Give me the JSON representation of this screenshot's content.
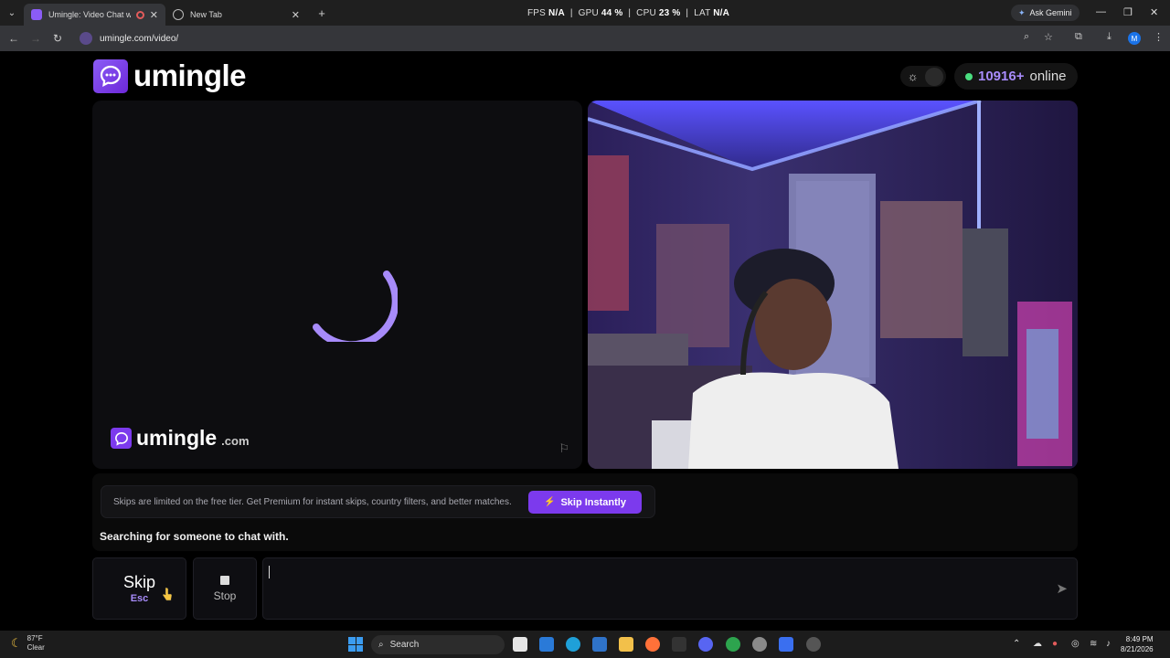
{
  "browser": {
    "tabs": [
      {
        "title": "Umingle: Video Chat with St",
        "active": true
      },
      {
        "title": "New Tab",
        "active": false
      }
    ],
    "perf": {
      "fps_label": "FPS",
      "fps": "N/A",
      "gpu_label": "GPU",
      "gpu": "44 %",
      "cpu_label": "CPU",
      "cpu": "23 %",
      "lat_label": "LAT",
      "lat": "N/A"
    },
    "ask_gemini": "Ask Gemini",
    "url": "umingle.com/video/",
    "profile_initial": "M"
  },
  "site": {
    "logo_text": "umingle",
    "online_count": "10916+",
    "online_label": "online",
    "watermark_text": "umingle",
    "watermark_suffix": ".com",
    "notice_text": "Skips are limited on the free tier. Get Premium for instant skips, country filters, and better matches.",
    "skip_instantly_label": "Skip Instantly",
    "status_text": "Searching for someone to chat with.",
    "skip_label": "Skip",
    "skip_key": "Esc",
    "stop_label": "Stop",
    "message_placeholder": ""
  },
  "colors": {
    "accent": "#7c3aed",
    "accent_light": "#a78bfa",
    "online_dot": "#4ade80"
  },
  "taskbar": {
    "weather_temp": "87°F",
    "weather_desc": "Clear",
    "search_label": "Search",
    "time": "8:49 PM",
    "date": "8/21/2026"
  }
}
